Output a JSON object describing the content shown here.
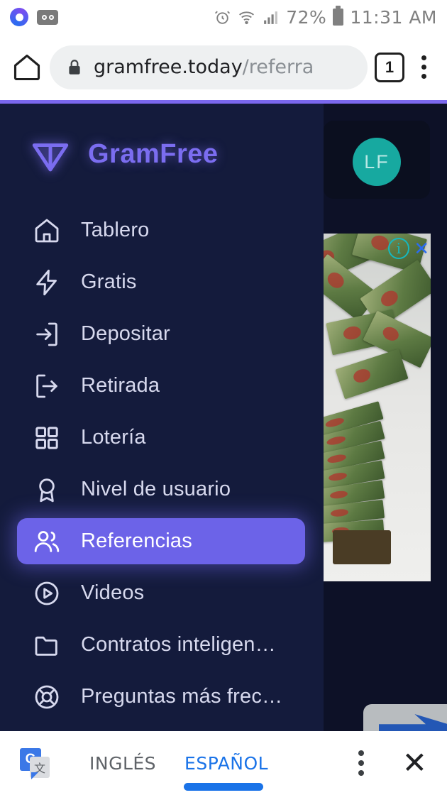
{
  "status_bar": {
    "left_icons": [
      "outlook-circle-icon",
      "voicemail-icon"
    ],
    "alarm_icon": "alarm-clock-icon",
    "wifi_icon": "wifi-icon",
    "signal_icon": "cell-signal-icon",
    "battery_percent": "72%",
    "battery_icon": "battery-icon",
    "time": "11:31 AM"
  },
  "browser": {
    "home_icon": "home-icon",
    "lock_icon": "lock-icon",
    "url_domain": "gramfree.today",
    "url_path": "/referra",
    "tab_count": "1",
    "menu_icon": "kebab-menu-icon",
    "progress_color": "#7b68ee"
  },
  "drawer": {
    "brand": {
      "logo_icon": "ton-diamond-icon",
      "name": "GramFree",
      "color": "#7b6df0"
    },
    "items": [
      {
        "label": "Tablero",
        "icon": "home-icon",
        "active": false
      },
      {
        "label": "Gratis",
        "icon": "lightning-icon",
        "active": false
      },
      {
        "label": "Depositar",
        "icon": "log-in-icon",
        "active": false
      },
      {
        "label": "Retirada",
        "icon": "log-out-icon",
        "active": false
      },
      {
        "label": "Lotería",
        "icon": "grid-icon",
        "active": false
      },
      {
        "label": "Nivel de usuario",
        "icon": "award-icon",
        "active": false
      },
      {
        "label": "Referencias",
        "icon": "users-icon",
        "active": true
      },
      {
        "label": "Videos",
        "icon": "play-circle-icon",
        "active": false
      },
      {
        "label": "Contratos inteligen…",
        "icon": "folder-icon",
        "active": false
      },
      {
        "label": "Preguntas más frec…",
        "icon": "life-buoy-icon",
        "active": false
      }
    ],
    "active_color": "#6c63e8",
    "background_color": "#141b3c"
  },
  "page": {
    "avatar_initials": "LF",
    "avatar_color": "#17a9a0",
    "ad_info_icon": "ad-info-icon",
    "ad_close_icon": "ad-close-icon",
    "ad_close_label": "✕"
  },
  "translate_bar": {
    "icon": "google-translate-icon",
    "icon_letter": "G",
    "source_language": "INGLÉS",
    "target_language": "ESPAÑOL",
    "selected_language": "ESPAÑOL",
    "menu_icon": "kebab-menu-icon",
    "close_icon": "close-icon",
    "close_label": "✕",
    "selected_color": "#1a73e8"
  }
}
